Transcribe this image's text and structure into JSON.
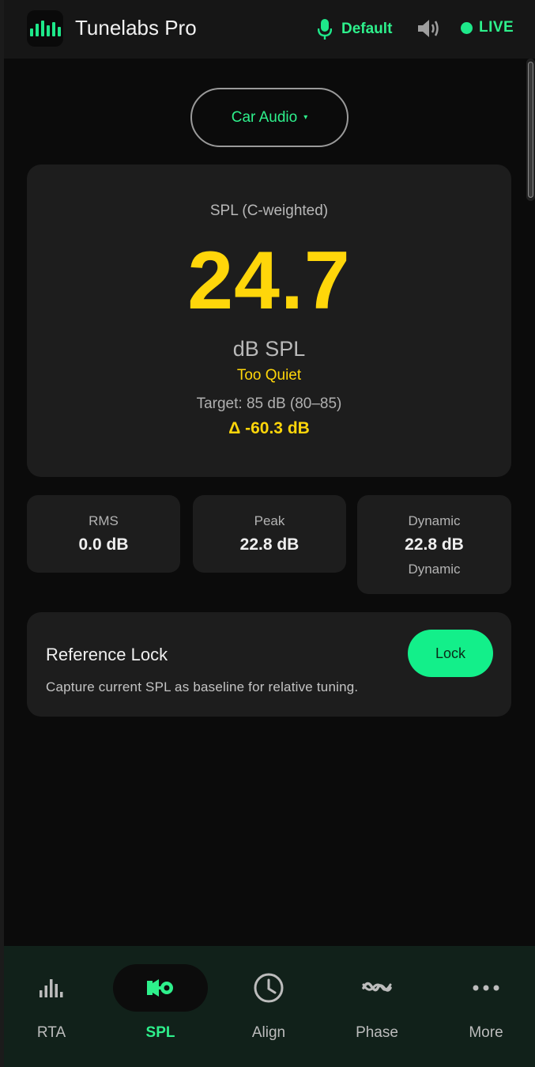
{
  "header": {
    "title": "Tunelabs Pro",
    "mic_label": "Default",
    "live_label": "LIVE",
    "icons": [
      "equalizer-logo-icon",
      "microphone-icon",
      "speaker-icon",
      "live-dot-icon"
    ]
  },
  "preset": {
    "label": "Car Audio",
    "caret": "▾"
  },
  "spl": {
    "heading": "SPL (C-weighted)",
    "value": "24.7",
    "unit": "dB SPL",
    "status": "Too Quiet",
    "target": "Target: 85 dB  (80–85)",
    "delta": "Δ -60.3 dB"
  },
  "stats": {
    "rms": {
      "label": "RMS",
      "value": "0.0 dB"
    },
    "peak": {
      "label": "Peak",
      "value": "22.8 dB"
    },
    "dynamic": {
      "label": "Dynamic",
      "value": "22.8 dB",
      "sub": "Dynamic"
    }
  },
  "reference_lock": {
    "title": "Reference Lock",
    "description": "Capture current SPL as baseline for relative tuning.",
    "button_label": "Lock"
  },
  "nav": {
    "items": [
      {
        "label": "RTA",
        "icon": "bar-chart-icon"
      },
      {
        "label": "SPL",
        "icon": "speaker-meter-icon",
        "active": true
      },
      {
        "label": "Align",
        "icon": "clock-icon"
      },
      {
        "label": "Phase",
        "icon": "wave-icon"
      },
      {
        "label": "More",
        "icon": "more-dots-icon"
      }
    ]
  },
  "colors": {
    "accent": "#1ee88a",
    "value_yellow": "#ffd60a",
    "card_bg": "#1d1d1d",
    "nav_bg": "#11211a"
  }
}
